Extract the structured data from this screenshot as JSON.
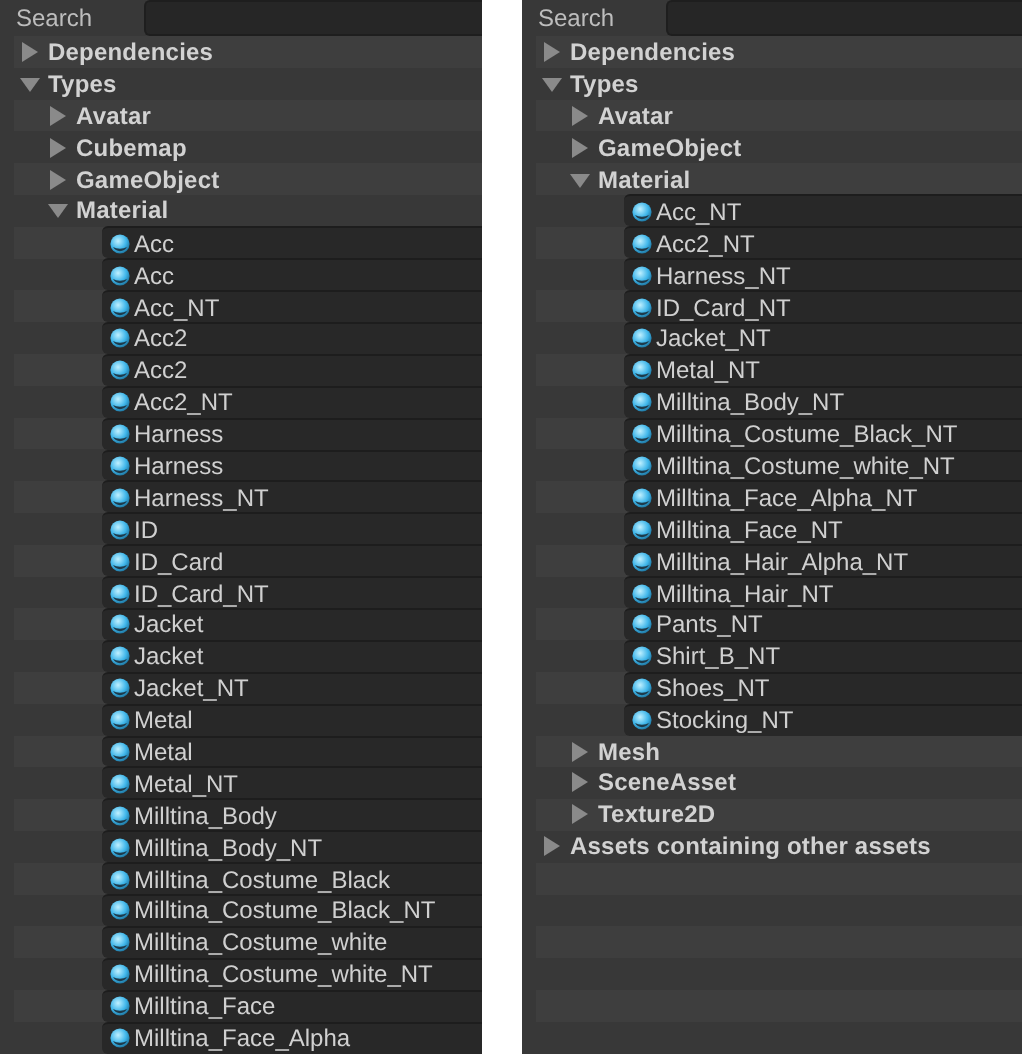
{
  "panels": [
    {
      "search": {
        "label": "Search"
      },
      "tree": [
        {
          "kind": "group",
          "label": "Dependencies",
          "expanded": false
        },
        {
          "kind": "group",
          "label": "Types",
          "expanded": true,
          "children": [
            {
              "kind": "group",
              "label": "Avatar",
              "expanded": false
            },
            {
              "kind": "group",
              "label": "Cubemap",
              "expanded": false
            },
            {
              "kind": "group",
              "label": "GameObject",
              "expanded": false
            },
            {
              "kind": "group",
              "label": "Material",
              "expanded": true,
              "children": [
                {
                  "kind": "asset",
                  "label": "Acc"
                },
                {
                  "kind": "asset",
                  "label": "Acc"
                },
                {
                  "kind": "asset",
                  "label": "Acc_NT"
                },
                {
                  "kind": "asset",
                  "label": "Acc2"
                },
                {
                  "kind": "asset",
                  "label": "Acc2"
                },
                {
                  "kind": "asset",
                  "label": "Acc2_NT"
                },
                {
                  "kind": "asset",
                  "label": "Harness"
                },
                {
                  "kind": "asset",
                  "label": "Harness"
                },
                {
                  "kind": "asset",
                  "label": "Harness_NT"
                },
                {
                  "kind": "asset",
                  "label": "ID"
                },
                {
                  "kind": "asset",
                  "label": "ID_Card"
                },
                {
                  "kind": "asset",
                  "label": "ID_Card_NT"
                },
                {
                  "kind": "asset",
                  "label": "Jacket"
                },
                {
                  "kind": "asset",
                  "label": "Jacket"
                },
                {
                  "kind": "asset",
                  "label": "Jacket_NT"
                },
                {
                  "kind": "asset",
                  "label": "Metal"
                },
                {
                  "kind": "asset",
                  "label": "Metal"
                },
                {
                  "kind": "asset",
                  "label": "Metal_NT"
                },
                {
                  "kind": "asset",
                  "label": "Milltina_Body"
                },
                {
                  "kind": "asset",
                  "label": "Milltina_Body_NT"
                },
                {
                  "kind": "asset",
                  "label": "Milltina_Costume_Black"
                },
                {
                  "kind": "asset",
                  "label": "Milltina_Costume_Black_NT"
                },
                {
                  "kind": "asset",
                  "label": "Milltina_Costume_white"
                },
                {
                  "kind": "asset",
                  "label": "Milltina_Costume_white_NT"
                },
                {
                  "kind": "asset",
                  "label": "Milltina_Face"
                },
                {
                  "kind": "asset",
                  "label": "Milltina_Face_Alpha"
                }
              ]
            }
          ]
        }
      ]
    },
    {
      "search": {
        "label": "Search"
      },
      "tree": [
        {
          "kind": "group",
          "label": "Dependencies",
          "expanded": false
        },
        {
          "kind": "group",
          "label": "Types",
          "expanded": true,
          "children": [
            {
              "kind": "group",
              "label": "Avatar",
              "expanded": false
            },
            {
              "kind": "group",
              "label": "GameObject",
              "expanded": false
            },
            {
              "kind": "group",
              "label": "Material",
              "expanded": true,
              "children": [
                {
                  "kind": "asset",
                  "label": "Acc_NT"
                },
                {
                  "kind": "asset",
                  "label": "Acc2_NT"
                },
                {
                  "kind": "asset",
                  "label": "Harness_NT"
                },
                {
                  "kind": "asset",
                  "label": "ID_Card_NT"
                },
                {
                  "kind": "asset",
                  "label": "Jacket_NT"
                },
                {
                  "kind": "asset",
                  "label": "Metal_NT"
                },
                {
                  "kind": "asset",
                  "label": "Milltina_Body_NT"
                },
                {
                  "kind": "asset",
                  "label": "Milltina_Costume_Black_NT"
                },
                {
                  "kind": "asset",
                  "label": "Milltina_Costume_white_NT"
                },
                {
                  "kind": "asset",
                  "label": "Milltina_Face_Alpha_NT"
                },
                {
                  "kind": "asset",
                  "label": "Milltina_Face_NT"
                },
                {
                  "kind": "asset",
                  "label": "Milltina_Hair_Alpha_NT"
                },
                {
                  "kind": "asset",
                  "label": "Milltina_Hair_NT"
                },
                {
                  "kind": "asset",
                  "label": "Pants_NT"
                },
                {
                  "kind": "asset",
                  "label": "Shirt_B_NT"
                },
                {
                  "kind": "asset",
                  "label": "Shoes_NT"
                },
                {
                  "kind": "asset",
                  "label": "Stocking_NT"
                }
              ]
            },
            {
              "kind": "group",
              "label": "Mesh",
              "expanded": false
            },
            {
              "kind": "group",
              "label": "SceneAsset",
              "expanded": false
            },
            {
              "kind": "group",
              "label": "Texture2D",
              "expanded": false
            }
          ]
        },
        {
          "kind": "group",
          "label": "Assets containing other assets",
          "expanded": false
        }
      ]
    }
  ]
}
